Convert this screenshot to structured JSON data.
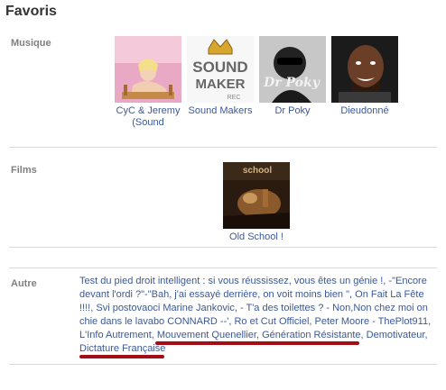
{
  "header": {
    "title": "Favoris"
  },
  "sections": {
    "musique": {
      "label": "Musique",
      "items": [
        {
          "name": "CyC & Jeremy (Sound",
          "icon": "cyc-jeremy-thumbnail"
        },
        {
          "name": "Sound Makers",
          "icon": "sound-makers-logo-thumbnail",
          "logo_text": "SOUND MAKERS REC"
        },
        {
          "name": "Dr Poky",
          "icon": "dr-poky-thumbnail",
          "logo_text": "Dr Poky"
        },
        {
          "name": "Dieudonné",
          "icon": "dieudonne-portrait-thumbnail"
        }
      ]
    },
    "films": {
      "label": "Films",
      "items": [
        {
          "name": "Old School !",
          "icon": "old-school-thumbnail",
          "logo_text": "school"
        }
      ]
    },
    "autre": {
      "label": "Autre",
      "items": [
        "Test du pied droit intelligent : si vous réussissez, vous êtes un génie !",
        "-\"Encore devant l'ordi ?\"-\"Bah, j'ai essayé derrière, on voit moins bien \"",
        "On Fait La Fête !!!!",
        "Svi postovaoci Marine Jankovic",
        "- T'a des toilettes ? - Non,Non chez moi on chie dans le lavabo CONNARD --'",
        "Ro et Cut Officiel",
        "Peter Moore - ThePlot911",
        "L'Info Autrement",
        "Mouvement Quenellier",
        "Génération Résistante",
        "Demotivateur",
        "Dictature Française"
      ]
    }
  },
  "colors": {
    "link": "#3b5998",
    "label": "#808080",
    "title": "#333333",
    "divider": "#d9d9d9",
    "annotation_underline": "#a50d14"
  }
}
